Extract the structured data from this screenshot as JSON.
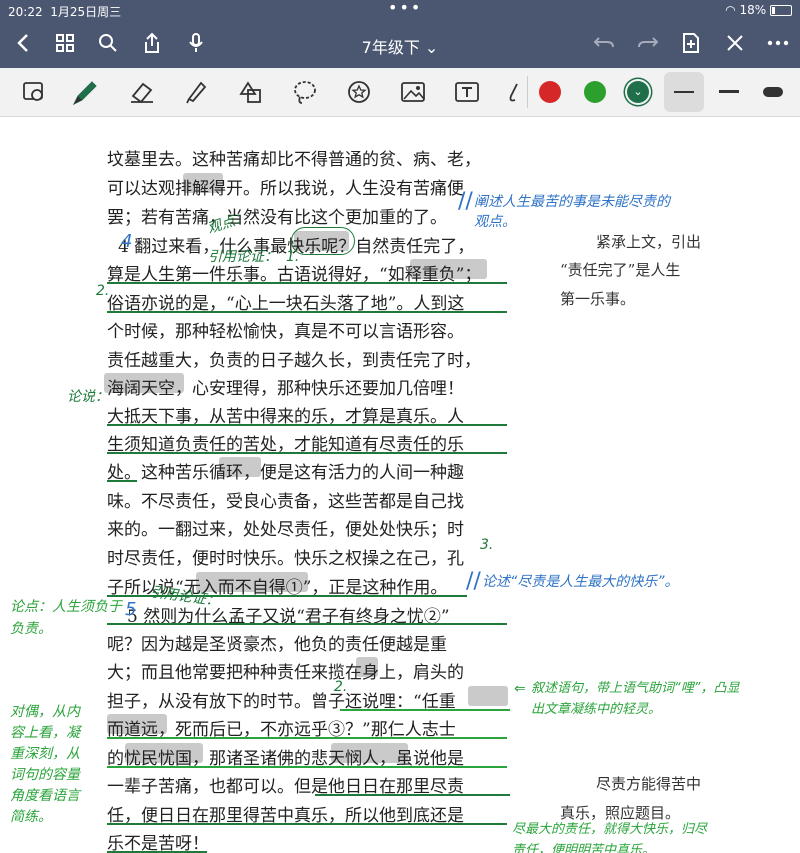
{
  "status_bar": {
    "time": "20:22",
    "date": "1月25日周三",
    "battery": "18%"
  },
  "nav": {
    "title": "7年级下 ⌄"
  },
  "toolbar": {
    "colors": [
      "#d62728",
      "#2ca02c",
      "#1f6f4a"
    ],
    "selected_color": "#1f6f4a"
  },
  "document": {
    "lines": [
      "坟墓里去。这种苦痛却比不得普通的贫、病、老，",
      "可以达观排解得开。所以我说，人生没有苦痛便",
      "罢；若有苦痛，当然没有比这个更加重的了。",
      "4  翻过来看，什么事最快乐呢？自然责任完了，",
      "算是人生第一件乐事。古语说得好，“如释重负”；",
      "俗语亦说的是，“心上一块石头落了地”。人到这",
      "个时候，那种轻松愉快，真是不可以言语形容。",
      "责任越重大，负责的日子越久长，到责任完了时，",
      "海阔天空，心安理得，那种快乐还要加几倍哩！",
      "大抵天下事，从苦中得来的乐，才算是真乐。人",
      "生须知道负责任的苦处，才能知道有尽责任的乐",
      "处。这种苦乐循环，便是这有活力的人间一种趣",
      "味。不尽责任，受良心责备，这些苦都是自己找",
      "来的。一翻过来，处处尽责任，便处处快乐；时",
      "时尽责任，便时时快乐。快乐之权操之在己，孔",
      "子所以说“无入而不自得①”，正是这种作用。",
      "5  然则为什么孟子又说“君子有终身之忧②”",
      "呢？因为越是圣贤豪杰，他负的责任便越是重",
      "大；而且他常要把种种责任来揽在身上，肩头的",
      "担子，从没有放下的时节。曾子还说哩：“任重",
      "而道远，死而后已，不亦远乎③？”那仁人志士",
      "的忧民忧国，那诸圣诸佛的悲天悯人，虽说他是",
      "一辈子苦痛，也都可以。但是他日日在那里尽责",
      "任，便日日在那里得苦中真乐，所以他到底还是",
      "乐不是苦呀！"
    ],
    "margin_notes": {
      "note1": [
        "紧承上文，引出",
        "“责任完了”是人生",
        "第一乐事。"
      ],
      "note2": [
        "尽责方能得苦中",
        "真乐，照应题目。"
      ]
    }
  },
  "annotations": {
    "blue_top": [
      "阐述人生最苦的事是未能尽责的",
      "观点。"
    ],
    "blue_mid": "论述“尽责是人生最大的快乐”。",
    "guandian": "观点：",
    "yinyong1": "引用论证：",
    "yinyong2": "引用论证：",
    "lundian_left": "论说：",
    "lundian2": [
      "论点：人生须负于",
      "负责。"
    ],
    "duiou": [
      "对偶，从内",
      "容上看，凝",
      "重深刻，从",
      "词句的容量",
      "角度看语言",
      "简练。"
    ],
    "xushu": [
      "叙述语句，带上语气助词“哩”，凸显",
      "出文章凝练中的轻灵。"
    ],
    "bottom": [
      "尽最大的责任，就得大快乐，归尽",
      "责任，便明明苦中真乐。"
    ],
    "num2a": "2.",
    "num2b": "2.",
    "num3": "3.",
    "num1": "1."
  }
}
